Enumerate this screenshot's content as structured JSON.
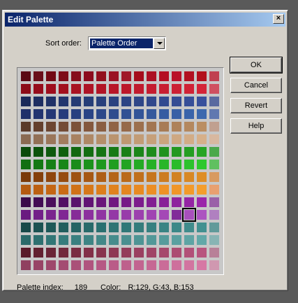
{
  "window": {
    "title": "Edit Palette",
    "close_glyph": "×"
  },
  "sort": {
    "label": "Sort order:",
    "selected": "Palette Order"
  },
  "buttons": {
    "ok": "OK",
    "cancel": "Cancel",
    "revert": "Revert",
    "help": "Help"
  },
  "status": {
    "index_label": "Palette index:",
    "index_value": "189",
    "color_label": "Color:",
    "color_value": "R:129, G:43, B:153"
  },
  "palette": {
    "rows": [
      [
        "#5a0a14",
        "#6a0f1a",
        "#720a14",
        "#7e0c18",
        "#860e1c",
        "#8c0c1e",
        "#92101e",
        "#9a1224",
        "#a01828",
        "#a50c1c",
        "#ac1024",
        "#b40e22",
        "#ba1028",
        "#b21020",
        "#b2101c",
        "#c04050"
      ],
      [
        "#8c0c18",
        "#960c1c",
        "#9e0e1e",
        "#a2101e",
        "#a81222",
        "#ae1426",
        "#b21426",
        "#b81628",
        "#bc182a",
        "#c01a2e",
        "#c41c30",
        "#c81e32",
        "#cc2034",
        "#d02236",
        "#d42438",
        "#d05060"
      ],
      [
        "#1a2a5a",
        "#1e2e62",
        "#203268",
        "#22366e",
        "#243a74",
        "#263e78",
        "#28407c",
        "#2a4280",
        "#2c4484",
        "#2e4688",
        "#30488c",
        "#324a90",
        "#344c94",
        "#364e98",
        "#38509c",
        "#5a6aa0"
      ],
      [
        "#20306a",
        "#223470",
        "#243876",
        "#263c7c",
        "#284080",
        "#2a4486",
        "#2c488a",
        "#2e4c8e",
        "#305094",
        "#325498",
        "#34589c",
        "#365ca2",
        "#3860a6",
        "#3a64aa",
        "#3c68ae",
        "#6078b0"
      ],
      [
        "#5a3a2a",
        "#64402e",
        "#6c4632",
        "#744c36",
        "#7c523a",
        "#84583e",
        "#8a5e42",
        "#906446",
        "#966a4a",
        "#9c704e",
        "#a27652",
        "#a87c56",
        "#ae825a",
        "#b4885e",
        "#ba8e62",
        "#c0a090"
      ],
      [
        "#8a6a52",
        "#927056",
        "#9a765a",
        "#a27c5e",
        "#a88262",
        "#ae8866",
        "#b48e6a",
        "#ba946e",
        "#be9872",
        "#c29c76",
        "#c6a07a",
        "#caa47e",
        "#cea882",
        "#d2ac86",
        "#d6b08a",
        "#d8b8a0"
      ],
      [
        "#0a4a0a",
        "#0c520c",
        "#0e5a0e",
        "#10600e",
        "#126810",
        "#146e12",
        "#167414",
        "#187a16",
        "#1a8018",
        "#1c861a",
        "#1e8c1c",
        "#20921e",
        "#229820",
        "#249e22",
        "#26a424",
        "#4aa84a"
      ],
      [
        "#127012",
        "#147814",
        "#168016",
        "#188618",
        "#1a8c1a",
        "#1c921c",
        "#1e981e",
        "#209e20",
        "#22a422",
        "#24aa24",
        "#26b026",
        "#28b628",
        "#2abc2a",
        "#2cc22c",
        "#2ec82e",
        "#60c060"
      ],
      [
        "#7a3a0a",
        "#84400c",
        "#8e460e",
        "#964c10",
        "#9e5212",
        "#a65814",
        "#ae5e16",
        "#b46418",
        "#ba6a1a",
        "#c0701c",
        "#c6761e",
        "#cc7c20",
        "#d28222",
        "#d88824",
        "#de8e26",
        "#d89a60"
      ],
      [
        "#b45a10",
        "#bc6012",
        "#c46614",
        "#ca6c16",
        "#d07218",
        "#d6781a",
        "#dc7e1c",
        "#e0821e",
        "#e48620",
        "#e88a22",
        "#ec8e24",
        "#ee9226",
        "#f09628",
        "#f29a2a",
        "#f49e2c",
        "#e8a070"
      ],
      [
        "#3a0a4a",
        "#420c54",
        "#4a0e5c",
        "#521064",
        "#5a126c",
        "#621474",
        "#6a167a",
        "#701880",
        "#761a86",
        "#7c1c8c",
        "#821e92",
        "#882098",
        "#8e229e",
        "#9424a4",
        "#9a26aa",
        "#9a60a8"
      ],
      [
        "#6a1a80",
        "#722088",
        "#7a248e",
        "#802894",
        "#862c98",
        "#8c309e",
        "#9034a2",
        "#9438a6",
        "#983caa",
        "#9c40ae",
        "#a044b2",
        "#a448b6",
        "#812b99",
        "#a850bc",
        "#ac54c0",
        "#b080c0"
      ],
      [
        "#184a4a",
        "#1c5252",
        "#1e5858",
        "#225e5e",
        "#246464",
        "#286a6a",
        "#2a7070",
        "#2e7474",
        "#307878",
        "#347c7c",
        "#368080",
        "#3a8484",
        "#3c8888",
        "#408c8c",
        "#429090",
        "#609a9a"
      ],
      [
        "#2a6a6a",
        "#2e7070",
        "#327676",
        "#367c7c",
        "#3a8080",
        "#3e8484",
        "#428888",
        "#468c8c",
        "#4a9090",
        "#4e9494",
        "#529898",
        "#569c9c",
        "#5aa0a0",
        "#5ea4a4",
        "#62a8a8",
        "#88b4b4"
      ],
      [
        "#5a1a2a",
        "#622030",
        "#6a2436",
        "#72283c",
        "#7a2c42",
        "#823048",
        "#88344e",
        "#8e3854",
        "#943c5a",
        "#9a4060",
        "#a04466",
        "#a6486c",
        "#ac4c72",
        "#b25078",
        "#b8547e",
        "#b88098"
      ],
      [
        "#904060",
        "#984466",
        "#9e486c",
        "#a44c72",
        "#aa5078",
        "#b0547e",
        "#b65884",
        "#ba5c88",
        "#be608c",
        "#c26490",
        "#c66894",
        "#ca6c98",
        "#ce709c",
        "#d274a0",
        "#d678a4",
        "#d098b0"
      ]
    ],
    "selected_index": 189
  }
}
